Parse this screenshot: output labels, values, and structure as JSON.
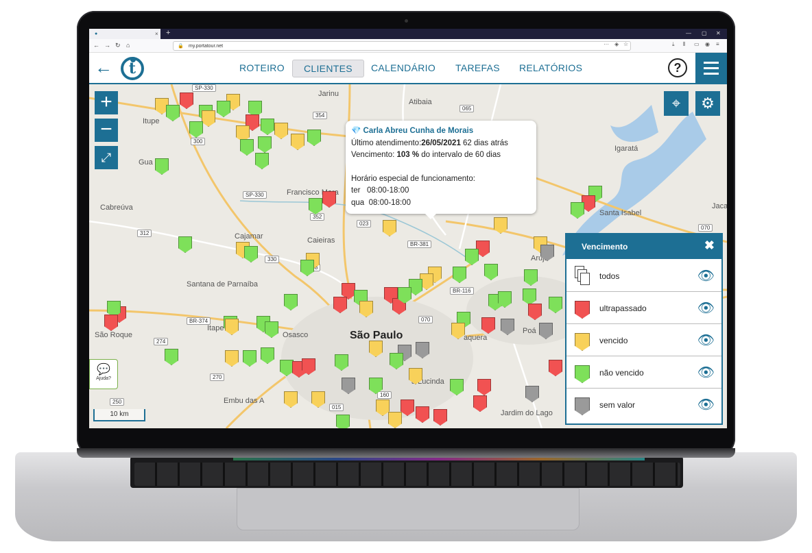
{
  "browser": {
    "url": "my.portatour.net",
    "tab_close": "×",
    "new_tab": "+"
  },
  "header": {
    "back_icon": "←",
    "logo_text": "t",
    "menu": [
      {
        "label": "ROTEIRO"
      },
      {
        "label": "CLIENTES"
      },
      {
        "label": "CALENDÁRIO"
      },
      {
        "label": "TAREFAS"
      },
      {
        "label": "RELATÓRIOS"
      }
    ],
    "help_label": "?"
  },
  "map": {
    "zoom_in": "+",
    "zoom_out": "−",
    "help_button_label": "Ajuda?",
    "scale_label": "10 km",
    "city_labels": [
      "Jarinu",
      "Atibaia",
      "Itupe",
      "Igaratá",
      "Gua",
      "Cabreúva",
      "Francisco Mora",
      "Santa Isabel",
      "Jaca",
      "Cajamar",
      "Caieiras",
      "Arujá",
      "Santana de Parnaíba",
      "São Roque",
      "Itapevi",
      "Osasco",
      "São Paulo",
      "Embu das A",
      "Jardim do Lago",
      "Poá",
      "a Lucinda",
      "aquera"
    ],
    "road_labels": [
      "SP-330",
      "065",
      "354",
      "300",
      "SP-330",
      "312",
      "352",
      "023",
      "BR-381",
      "070",
      "330",
      "348",
      "BR-116",
      "BR-374",
      "070",
      "274",
      "270",
      "250",
      "160",
      "015"
    ]
  },
  "popup": {
    "name": "Carla Abreu Cunha de Morais",
    "last_visit_label": "Último atendimento:",
    "last_visit_date": "26/05/2021",
    "last_visit_ago": " 62 dias atrás",
    "due_label": "Vencimento: ",
    "due_percent": "103 %",
    "due_suffix": " do intervalo de 60 dias",
    "special_hours_title": "Horário especial de funcionamento:",
    "hours": [
      {
        "day": "ter",
        "time": "08:00-18:00"
      },
      {
        "day": "qua",
        "time": "08:00-18:00"
      }
    ]
  },
  "legend": {
    "title": "Vencimento",
    "close_icon": "✖",
    "items": [
      {
        "label": "todos"
      },
      {
        "label": "ultrapassado",
        "color": "#f15252"
      },
      {
        "label": "vencido",
        "color": "#f8d15a"
      },
      {
        "label": "não vencido",
        "color": "#7ee05a"
      },
      {
        "label": "sem valor",
        "color": "#9a9a9a"
      }
    ]
  },
  "colors": {
    "brand": "#1d6f94",
    "red": "#f15252",
    "yellow": "#f8d15a",
    "green": "#7ee05a",
    "gray": "#9a9a9a"
  }
}
